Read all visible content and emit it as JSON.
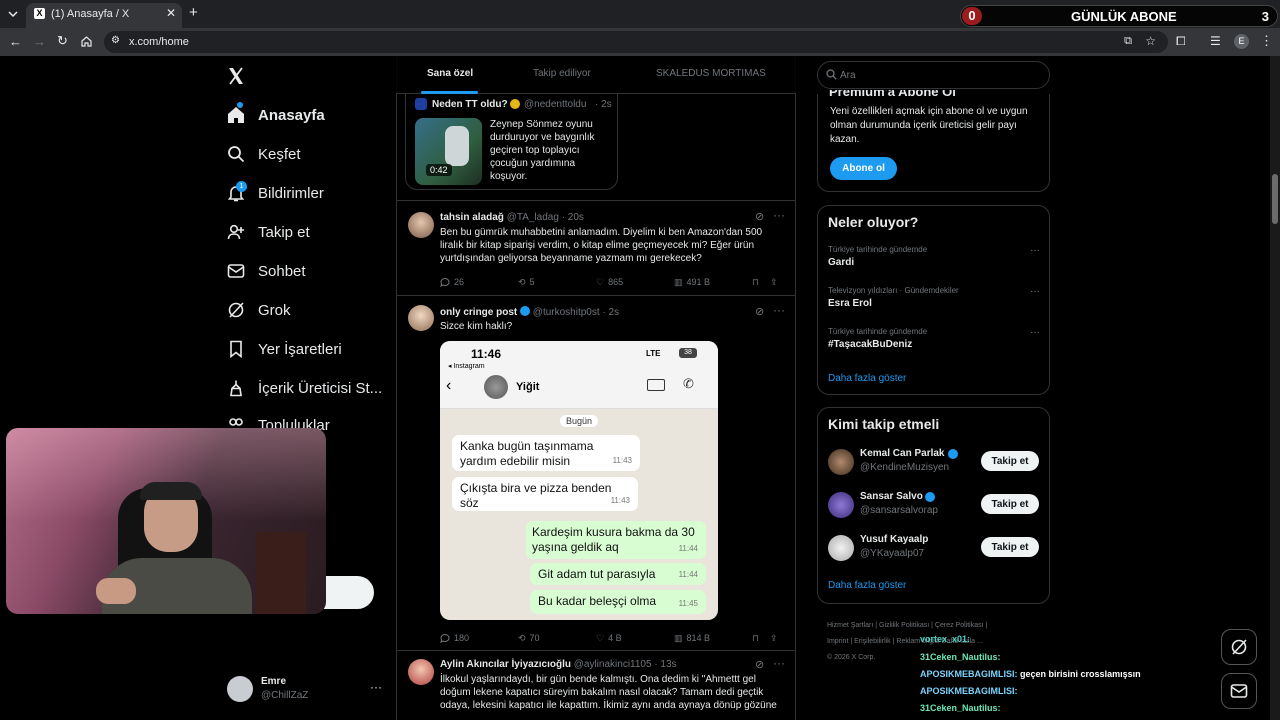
{
  "browser": {
    "tab_title": "(1) Anasayfa / X",
    "url": "x.com/home",
    "profile_initial": "E"
  },
  "overlay": {
    "left_count": "0",
    "title": "GÜNLÜK ABONE",
    "right_count": "3"
  },
  "nav": {
    "items": [
      {
        "label": "Anasayfa",
        "icon": "home-icon"
      },
      {
        "label": "Keşfet",
        "icon": "search-icon"
      },
      {
        "label": "Bildirimler",
        "icon": "bell-icon",
        "badge": "1"
      },
      {
        "label": "Takip et",
        "icon": "person-plus-icon"
      },
      {
        "label": "Sohbet",
        "icon": "mail-icon"
      },
      {
        "label": "Grok",
        "icon": "grok-icon"
      },
      {
        "label": "Yer İşaretleri",
        "icon": "bookmark-icon"
      },
      {
        "label": "İçerik Üreticisi St...",
        "icon": "creator-icon"
      },
      {
        "label": "Topluluklar",
        "icon": "communities-icon"
      }
    ],
    "post_button": "la",
    "account_name": "Emre",
    "account_handle": "@ChillZaZ",
    "account_more": "···"
  },
  "timeline": {
    "tabs": [
      "Sana özel",
      "Takip ediliyor",
      "SKALEDUS MORTIMAS"
    ],
    "active_tab": 0,
    "quote": {
      "author": "Neden TT oldu?",
      "handle": "@nedenttoldu",
      "time": "· 2s",
      "video_duration": "0:42",
      "text": "Zeynep Sönmez oyunu durduruyor ve baygınlık geçiren top toplayıcı çocuğun yardımına koşuyor."
    },
    "tweets": [
      {
        "author": "tahsin aladağ",
        "handle": "@TA_ladag",
        "time": "· 20s",
        "text": "Ben bu gümrük muhabbetini anlamadım. Diyelim ki ben Amazon'dan 500 liralık bir kitap siparişi verdim, o kitap elime geçmeyecek mi? Eğer ürün yurtdışından geliyorsa beyanname yazmam mı gerekecek?",
        "replies": "26",
        "reposts": "5",
        "likes": "865",
        "views": "491 B"
      },
      {
        "author": "only cringe post",
        "handle": "@turkoshitp0st",
        "time": "· 2s",
        "text": "Sizce kim haklı?",
        "replies": "180",
        "reposts": "70",
        "likes": "4 B",
        "views": "814 B"
      },
      {
        "author": "Aylin Akıncılar İyiyazıcıoğlu",
        "handle": "@aylinakinci1105",
        "time": "· 13s",
        "text": "İlkokul yaşlarındaydı, bir gün bende kalmıştı. Ona dedim ki \"Ahmettt gel doğum lekene kapatıcı süreyim bakalım nasıl olacak? Tamam dedi geçtik odaya, lekesini kapatıcı ile kapattım. İkimiz aynı anda aynaya dönüp gözüne"
      }
    ]
  },
  "phone_screenshot": {
    "clock": "11:46",
    "back_app": "◂ Instagram",
    "network": "LTE",
    "battery": "38",
    "contact": "Yiğit",
    "day_label": "Bugün",
    "messages": [
      {
        "text": "Kanka bugün taşınmama yardım edebilir misin",
        "time": "11:43",
        "side": "in"
      },
      {
        "text": "Çıkışta bira ve pizza benden söz",
        "time": "11:43",
        "side": "in"
      },
      {
        "text": "Kardeşim kusura bakma da 30 yaşına geldik aq",
        "time": "11:44",
        "side": "out"
      },
      {
        "text": "Git adam tut parasıyla",
        "time": "11:44",
        "side": "out"
      },
      {
        "text": "Bu kadar beleşçi olma",
        "time": "11:45",
        "side": "out"
      }
    ]
  },
  "sidebar": {
    "search_placeholder": "Ara",
    "premium": {
      "title": "Premium'a Abone Ol",
      "text": "Yeni özellikleri açmak için abone ol ve uygun olman durumunda içerik üreticisi gelir payı kazan.",
      "button": "Abone ol"
    },
    "trends": {
      "title": "Neler oluyor?",
      "items": [
        {
          "meta": "Türkiye tarihinde gündemde",
          "name": "Gardi"
        },
        {
          "meta": "Televizyon yıldızları · Gündemdekiler",
          "name": "Esra Erol"
        },
        {
          "meta": "Türkiye tarihinde gündemde",
          "name": "#TaşacakBuDeniz"
        }
      ],
      "show_more": "Daha fazla göster"
    },
    "who_to_follow": {
      "title": "Kimi takip etmeli",
      "users": [
        {
          "name": "Kemal Can Parlak",
          "handle": "@KendineMuzisyen",
          "verified": true
        },
        {
          "name": "Sansar Salvo",
          "handle": "@sansarsalvorap",
          "verified": true
        },
        {
          "name": "Yusuf Kayaalp",
          "handle": "@YKayaalp07",
          "verified": false
        }
      ],
      "follow_label": "Takip et",
      "show_more": "Daha fazla göster"
    },
    "footer": {
      "links": [
        "Hizmet Şartları",
        "Gizlilik Politikası",
        "Çerez Politikası",
        "Imprint",
        "Erişilebilirlik",
        "Reklam bilgisi",
        "Daha fazla ..."
      ],
      "copyright": "© 2026 X Corp."
    }
  },
  "chat": [
    {
      "user": "vortex_x01:",
      "msg": "",
      "color": "#4fd1c5"
    },
    {
      "user": "31Ceken_Nautilus:",
      "msg": "",
      "color": "#6ee7b7"
    },
    {
      "user": "APOSIKMEBAGIMLISI:",
      "msg": "geçen birisini crosslamışsın",
      "color": "#7dd3fc"
    },
    {
      "user": "APOSIKMEBAGIMLISI:",
      "msg": "",
      "color": "#7dd3fc"
    },
    {
      "user": "31Ceken_Nautilus:",
      "msg": "",
      "color": "#6ee7b7"
    }
  ],
  "colors": {
    "accent": "#1d9bf0",
    "background": "#000000",
    "border": "#2f3336",
    "muted_text": "#71767b"
  }
}
